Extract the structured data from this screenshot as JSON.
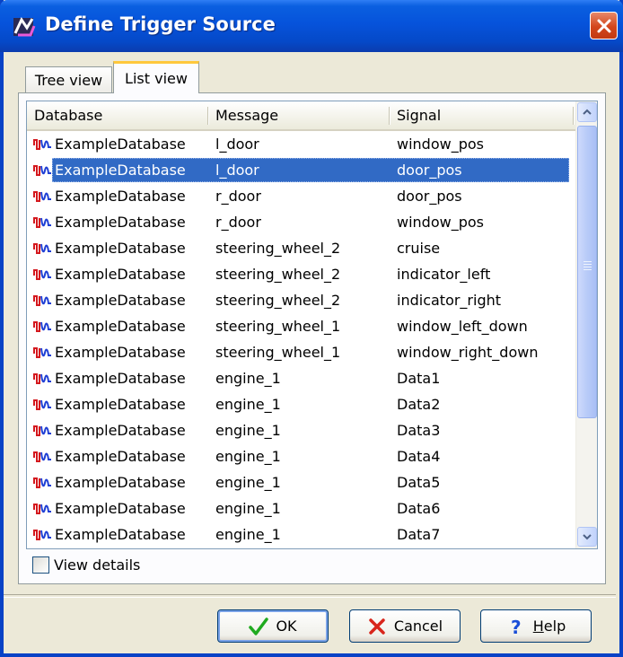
{
  "window": {
    "title": "Define Trigger Source",
    "close_icon": "close-icon",
    "app_icon": "trigger-source-app-icon"
  },
  "tabs": [
    {
      "label": "Tree view",
      "active": false
    },
    {
      "label": "List view",
      "active": true
    }
  ],
  "list": {
    "columns": [
      "Database",
      "Message",
      "Signal"
    ],
    "selected_index": 1,
    "row_icon": "database-signal-icon",
    "rows": [
      {
        "database": "ExampleDatabase",
        "message": "l_door",
        "signal": "window_pos"
      },
      {
        "database": "ExampleDatabase",
        "message": "l_door",
        "signal": "door_pos"
      },
      {
        "database": "ExampleDatabase",
        "message": "r_door",
        "signal": "door_pos"
      },
      {
        "database": "ExampleDatabase",
        "message": "r_door",
        "signal": "window_pos"
      },
      {
        "database": "ExampleDatabase",
        "message": "steering_wheel_2",
        "signal": "cruise"
      },
      {
        "database": "ExampleDatabase",
        "message": "steering_wheel_2",
        "signal": "indicator_left"
      },
      {
        "database": "ExampleDatabase",
        "message": "steering_wheel_2",
        "signal": "indicator_right"
      },
      {
        "database": "ExampleDatabase",
        "message": "steering_wheel_1",
        "signal": "window_left_down"
      },
      {
        "database": "ExampleDatabase",
        "message": "steering_wheel_1",
        "signal": "window_right_down"
      },
      {
        "database": "ExampleDatabase",
        "message": "engine_1",
        "signal": "Data1"
      },
      {
        "database": "ExampleDatabase",
        "message": "engine_1",
        "signal": "Data2"
      },
      {
        "database": "ExampleDatabase",
        "message": "engine_1",
        "signal": "Data3"
      },
      {
        "database": "ExampleDatabase",
        "message": "engine_1",
        "signal": "Data4"
      },
      {
        "database": "ExampleDatabase",
        "message": "engine_1",
        "signal": "Data5"
      },
      {
        "database": "ExampleDatabase",
        "message": "engine_1",
        "signal": "Data6"
      },
      {
        "database": "ExampleDatabase",
        "message": "engine_1",
        "signal": "Data7"
      }
    ]
  },
  "view_details": {
    "label": "View details",
    "checked": false
  },
  "buttons": {
    "ok": {
      "label": "OK",
      "icon": "checkmark-icon"
    },
    "cancel": {
      "label": "Cancel",
      "icon": "x-icon"
    },
    "help": {
      "label_prefix": "",
      "label_underlined": "H",
      "label_rest": "elp",
      "icon": "question-mark-icon"
    }
  },
  "colors": {
    "titlebar": "#0653db",
    "selection": "#316ac5",
    "face": "#ece9d8"
  }
}
